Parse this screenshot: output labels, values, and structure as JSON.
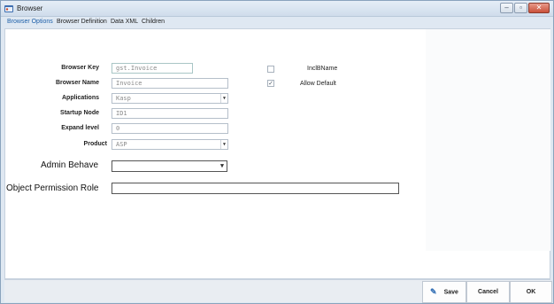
{
  "window": {
    "title": "Browser"
  },
  "tabs": [
    "Browser Options",
    "Browser Definition",
    "Data XML",
    "Children"
  ],
  "form": {
    "browser_key": {
      "label": "Browser Key",
      "value": "gst.Invoice"
    },
    "browser_name": {
      "label": "Browser Name",
      "value": "Invoice"
    },
    "applications": {
      "label": "Applications",
      "value": "Kasp"
    },
    "startup_node": {
      "label": "Startup Node",
      "value": "ID1"
    },
    "expand_level": {
      "label": "Expand level",
      "value": "0"
    },
    "product": {
      "label": "Product",
      "value": "ASP"
    },
    "admin_behave": {
      "label": "Admin Behave",
      "value": ""
    },
    "object_permission_role": {
      "label": "Object Permission Role",
      "value": ""
    }
  },
  "options": {
    "incl_bname": {
      "label": "InclBName",
      "checked": false
    },
    "allow_default": {
      "label": "Allow Default",
      "checked": true
    }
  },
  "buttons": {
    "save": "Save",
    "cancel": "Cancel",
    "ok": "OK"
  },
  "colors": {
    "accent": "#1d5fa8",
    "window_bg": "#dfe8f2"
  }
}
